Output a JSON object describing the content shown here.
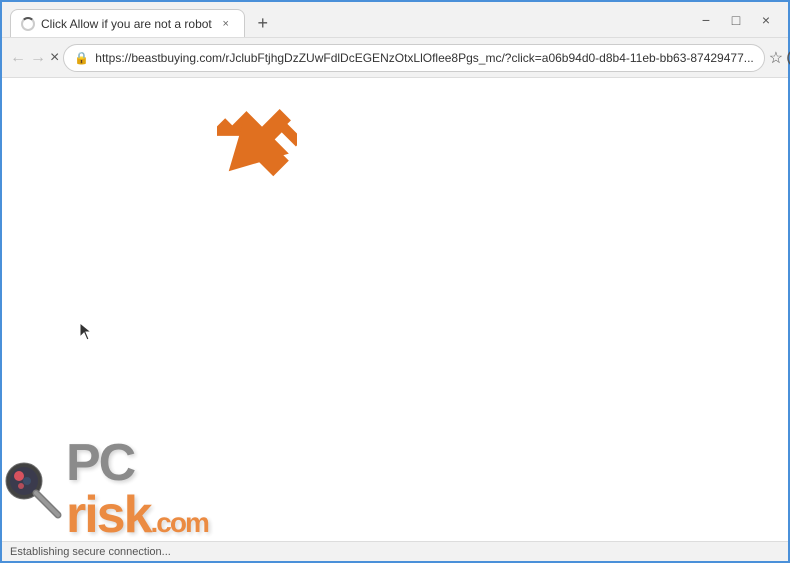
{
  "window": {
    "title": "Click Allow if you are not a robot"
  },
  "tab": {
    "title": "Click Allow if you are not a robot",
    "close_label": "×"
  },
  "controls": {
    "minimize": "−",
    "restore": "□",
    "close": "×"
  },
  "nav": {
    "back_label": "←",
    "forward_label": "→",
    "close_label": "×",
    "url": "https://beastbuying.com/rJclubFtjhgDzZUwFdlDcEGENzOtxLlOflee8Pgs_mc/?click=a06b94d0-d8b4-11eb-bb63-87429477...",
    "lock_icon": "🔒",
    "star_icon": "☆",
    "new_tab_label": "+"
  },
  "status_bar": {
    "text": "Establishing secure connection..."
  },
  "watermark": {
    "pc_text": "PC",
    "risk_text": "risk",
    "dot_com": ".com"
  }
}
